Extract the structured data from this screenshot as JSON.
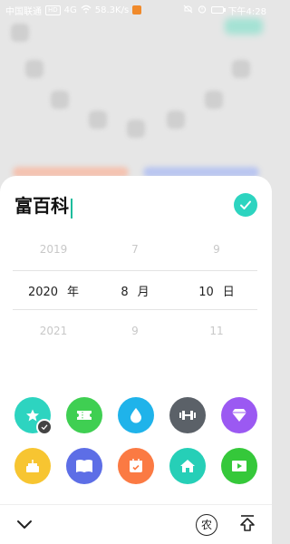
{
  "status_bar": {
    "carrier": "中国联通",
    "network_badge": "HD",
    "network_type": "4G",
    "speed": "58.3K/s",
    "time": "下午4:28"
  },
  "editor": {
    "title_text": "富百科"
  },
  "date_picker": {
    "prev": {
      "year": "2019",
      "month": "7",
      "day": "9"
    },
    "selected": {
      "year": "2020",
      "month": "8",
      "day": "10"
    },
    "next": {
      "year": "2021",
      "month": "9",
      "day": "11"
    },
    "units": {
      "year": "年",
      "month": "月",
      "day": "日"
    }
  },
  "bottom_bar": {
    "lunar_label": "农"
  },
  "colors": {
    "teal": "#2dd4c0",
    "green": "#3fcf52",
    "blue": "#1fb3ea",
    "dark": "#5b6168",
    "purple": "#9b59f2",
    "yellow": "#f7c531",
    "indigo": "#5d6ee6",
    "orange": "#fb7a43",
    "teal2": "#26cfb7",
    "lime": "#35c83a"
  },
  "icons": [
    {
      "name": "star-icon",
      "color": "teal",
      "selected": true
    },
    {
      "name": "ticket-icon",
      "color": "green"
    },
    {
      "name": "drop-icon",
      "color": "blue"
    },
    {
      "name": "dumbbell-icon",
      "color": "dark"
    },
    {
      "name": "diamond-icon",
      "color": "purple"
    },
    {
      "name": "cake-icon",
      "color": "yellow"
    },
    {
      "name": "book-icon",
      "color": "indigo"
    },
    {
      "name": "calendar-icon",
      "color": "orange"
    },
    {
      "name": "home-icon",
      "color": "teal2"
    },
    {
      "name": "video-icon",
      "color": "lime"
    }
  ]
}
